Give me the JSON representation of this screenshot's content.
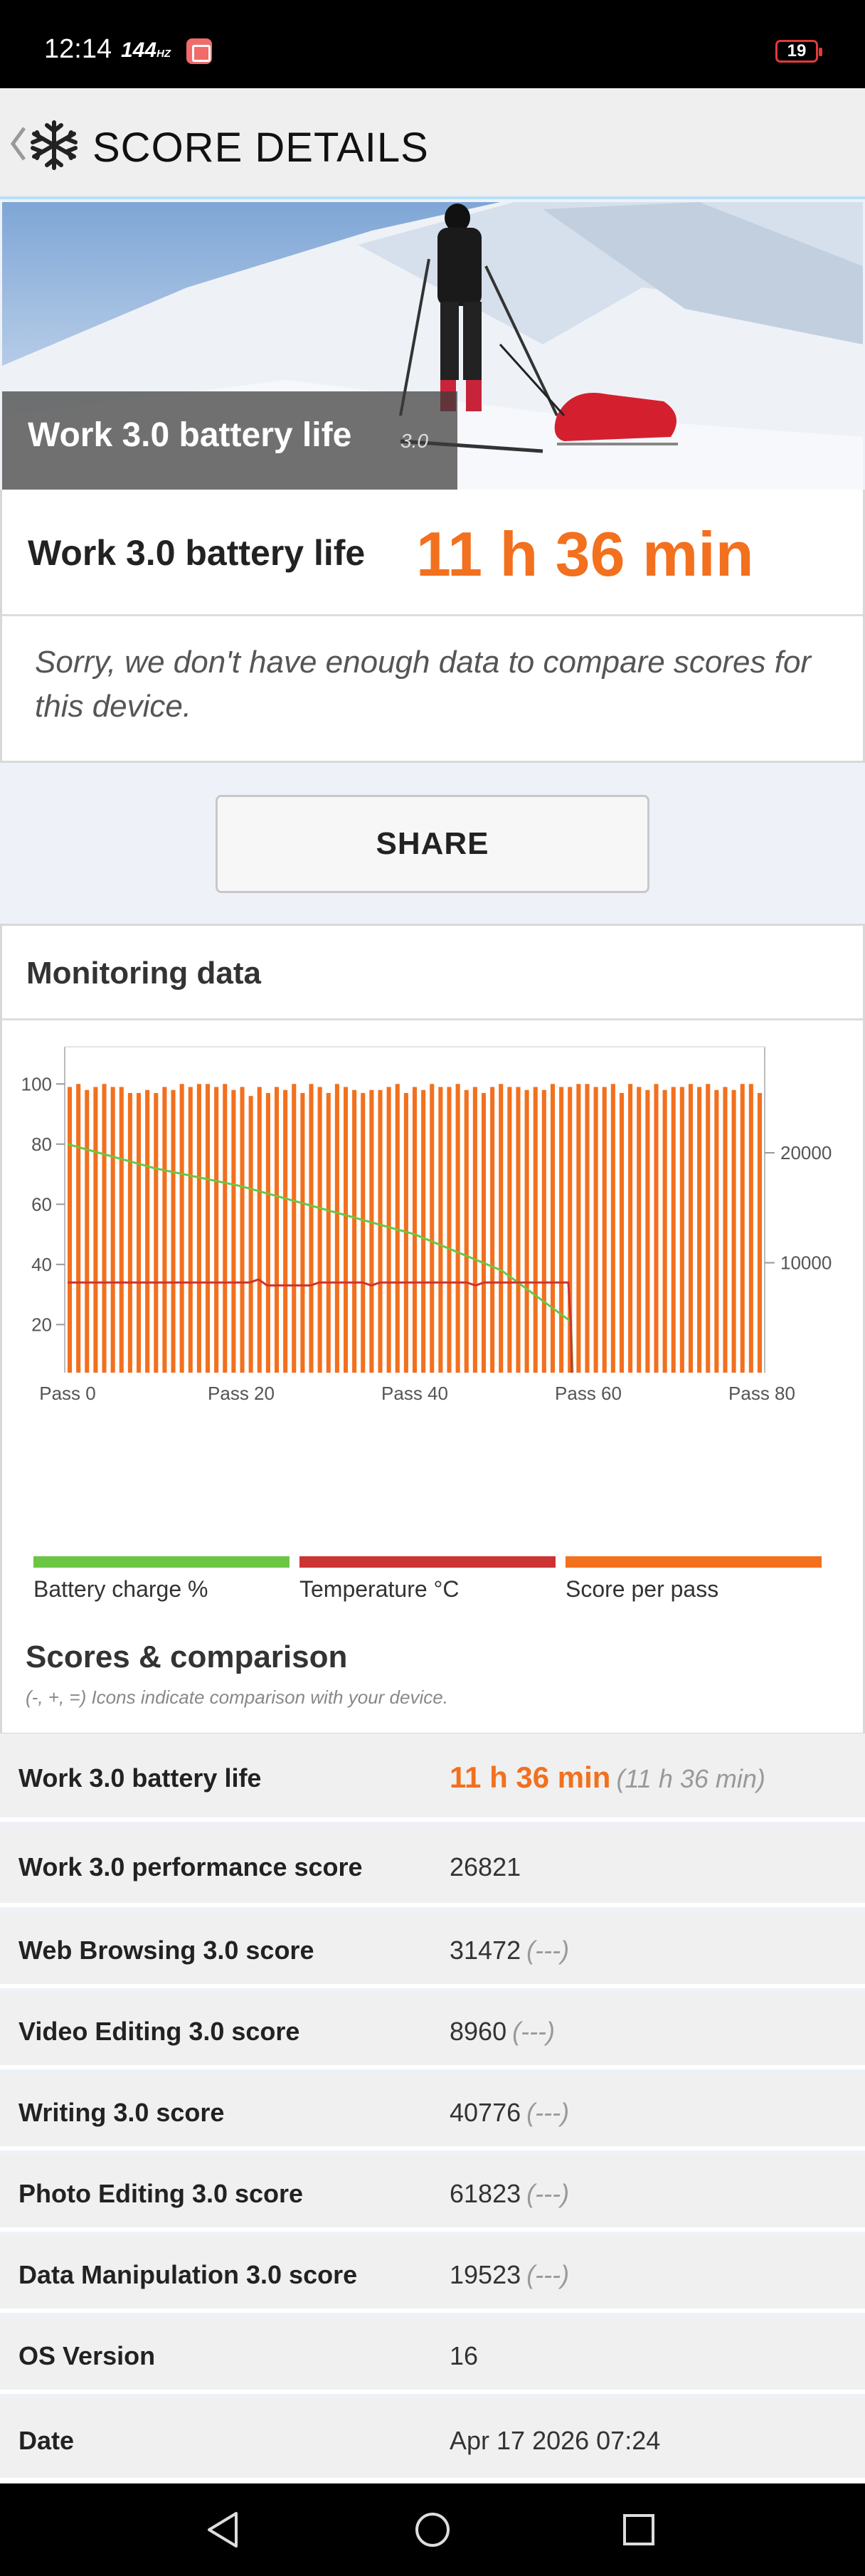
{
  "status_bar": {
    "time": "12:14",
    "refresh": "144",
    "refresh_unit": "HZ",
    "battery": "19"
  },
  "header": {
    "title": "SCORE DETAILS"
  },
  "hero": {
    "caption": "Work 3.0 battery life",
    "version": "3.0"
  },
  "score": {
    "label": "Work 3.0 battery life",
    "value": "11 h 36 min",
    "message": "Sorry, we don't have enough data to compare scores for this device."
  },
  "share": {
    "label": "SHARE"
  },
  "monitoring": {
    "title": "Monitoring data",
    "legend": [
      {
        "label": "Battery charge %",
        "color": "#6cc644"
      },
      {
        "label": "Temperature °C",
        "color": "#cc3333"
      },
      {
        "label": "Score per pass",
        "color": "#f2701e"
      }
    ]
  },
  "chart_data": {
    "type": "bar",
    "x_tick_labels": [
      "Pass 0",
      "Pass 20",
      "Pass 40",
      "Pass 60",
      "Pass 80"
    ],
    "x_range": [
      0,
      80
    ],
    "left_ticks": [
      20,
      40,
      60,
      80,
      100
    ],
    "left_range": [
      4,
      110
    ],
    "right_ticks": [
      10000,
      20000
    ],
    "right_range": [
      0,
      29000
    ],
    "grid": false,
    "series": [
      {
        "name": "Score per pass",
        "axis": "left",
        "values": [
          99,
          100,
          98,
          99,
          100,
          99,
          99,
          97,
          97,
          98,
          97,
          99,
          98,
          100,
          99,
          100,
          100,
          99,
          100,
          98,
          99,
          96,
          99,
          97,
          99,
          98,
          100,
          97,
          100,
          99,
          97,
          100,
          99,
          98,
          97,
          98,
          98,
          99,
          100,
          97,
          99,
          98,
          100,
          99,
          99,
          100,
          98,
          99,
          97,
          99,
          100,
          99,
          99,
          98,
          99,
          98,
          100,
          99,
          99,
          100,
          100,
          99,
          99,
          100,
          97,
          100,
          99,
          98,
          100,
          98,
          99,
          99,
          100,
          99,
          100,
          98,
          99,
          98,
          100,
          100,
          97
        ]
      },
      {
        "name": "Battery charge %",
        "axis": "left",
        "x": [
          0,
          5,
          10,
          20,
          30,
          40,
          50,
          58,
          58.2
        ],
        "values": [
          80,
          76,
          72,
          66,
          58,
          50,
          38,
          21,
          4
        ]
      },
      {
        "name": "Temperature °C",
        "axis": "left",
        "x": [
          0,
          21,
          22,
          23,
          28,
          29,
          34,
          35,
          36,
          46,
          47,
          48,
          57.7,
          58,
          58.1
        ],
        "values": [
          34,
          34,
          35,
          33,
          33,
          34,
          34,
          33,
          34,
          34,
          33,
          34,
          34,
          20,
          4
        ]
      }
    ]
  },
  "scores": {
    "title": "Scores & comparison",
    "note": "(-, +, =) Icons indicate comparison with your device.",
    "rows": [
      {
        "label": "Work 3.0 battery life",
        "value": "11 h 36 min",
        "compare": "(11 h 36 min)"
      },
      {
        "label": "Work 3.0 performance score",
        "value": "26821",
        "compare": ""
      },
      {
        "label": "Web Browsing 3.0 score",
        "value": "31472",
        "compare": "(---)"
      },
      {
        "label": "Video Editing 3.0 score",
        "value": "8960",
        "compare": "(---)"
      },
      {
        "label": "Writing 3.0 score",
        "value": "40776",
        "compare": "(---)"
      },
      {
        "label": "Photo Editing 3.0 score",
        "value": "61823",
        "compare": "(---)"
      },
      {
        "label": "Data Manipulation 3.0 score",
        "value": "19523",
        "compare": "(---)"
      },
      {
        "label": "OS Version",
        "value": "16",
        "compare": ""
      },
      {
        "label": "Date",
        "value": "Apr 17 2026 07:24",
        "compare": ""
      }
    ]
  },
  "colors": {
    "accent": "#f2701e",
    "battery": "#6cc644",
    "temperature": "#cc3333"
  }
}
